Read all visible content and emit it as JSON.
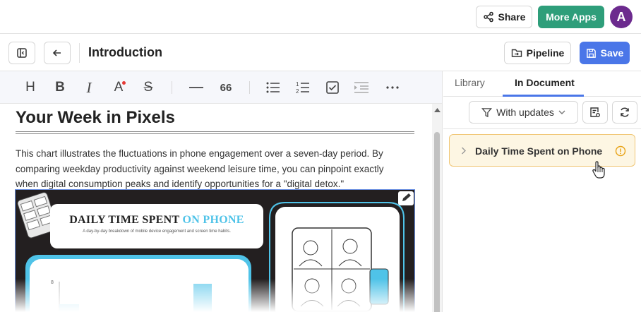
{
  "header": {
    "share_label": "Share",
    "more_apps_label": "More Apps",
    "avatar_letter": "A",
    "brand_color": "#2e9e7a",
    "avatar_color": "#6c2a8e"
  },
  "docbar": {
    "title": "Introduction",
    "pipeline_label": "Pipeline",
    "save_label": "Save",
    "save_color": "#4a76e8"
  },
  "editor": {
    "heading": "Your Week in Pixels",
    "paragraph": "This chart illustrates the fluctuations in phone engagement over a seven-day period. By comparing weekday productivity against weekend leisure time, you can pinpoint exactly when digital consumption peaks and identify opportunities for a \"digital detox.\"",
    "toolbar": [
      "heading-icon",
      "bold-icon",
      "italic-icon",
      "text-color-icon",
      "strikethrough-icon",
      "divider-icon",
      "quote-icon",
      "bullet-list-icon",
      "numbered-list-icon",
      "checklist-icon",
      "indent-icon",
      "more-icon"
    ],
    "image": {
      "title_main": "DAILY TIME SPENT",
      "title_accent": "ON PHONE",
      "subtitle": "A day-by-day breakdown of mobile device engagement and screen time habits.",
      "axis_tick": "8",
      "accent_color": "#4fc3e8"
    }
  },
  "panel": {
    "tabs": [
      {
        "label": "Library"
      },
      {
        "label": "In Document"
      }
    ],
    "filter_label": "With updates",
    "items": [
      {
        "label": "Daily Time Spent on Phone",
        "status": "warning"
      }
    ]
  }
}
